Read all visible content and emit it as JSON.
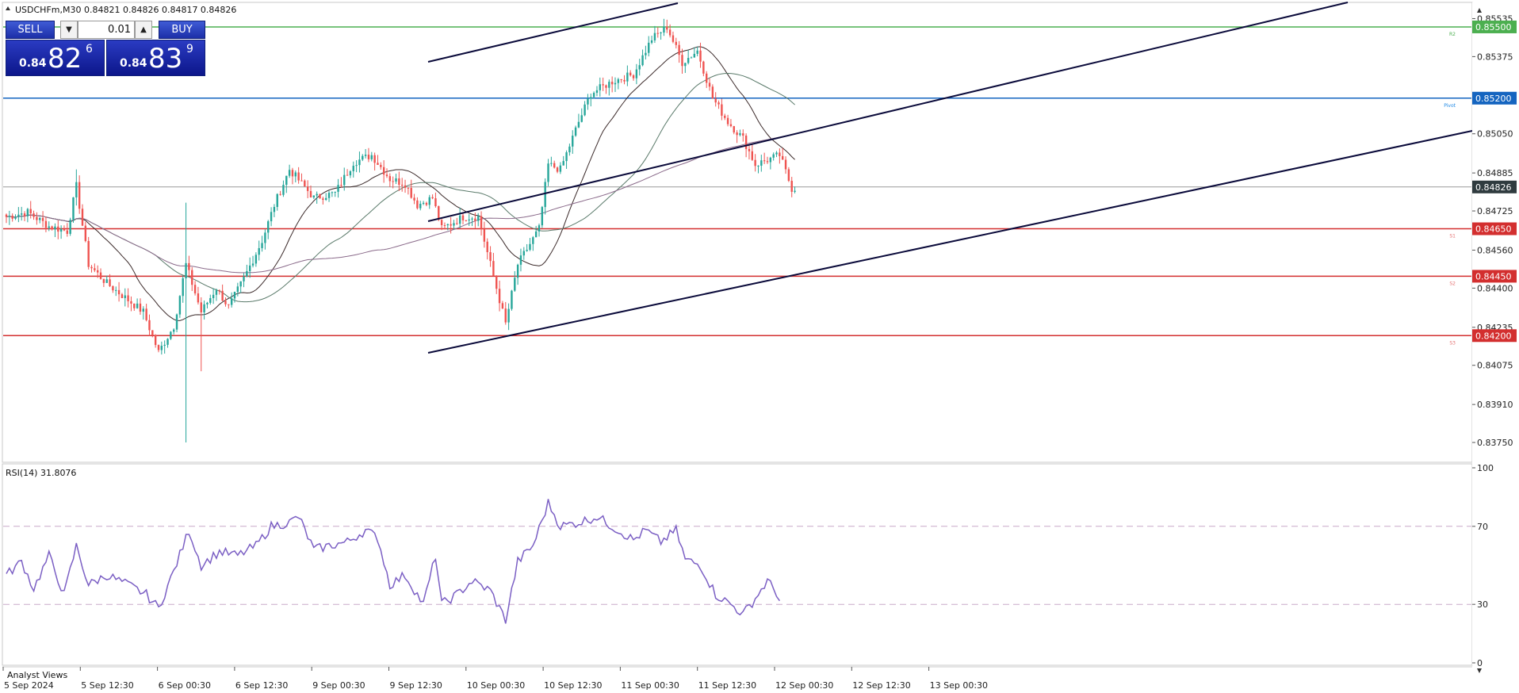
{
  "header": {
    "symbol_line": "USDCHFm,M30  0.84821 0.84826 0.84817 0.84826"
  },
  "trade_panel": {
    "sell_label": "SELL",
    "buy_label": "BUY",
    "lot": "0.01",
    "sell_price": {
      "prefix": "0.84",
      "big": "82",
      "sup": "6"
    },
    "buy_price": {
      "prefix": "0.84",
      "big": "83",
      "sup": "9"
    }
  },
  "rsi_label": "RSI(14) 31.8076",
  "analyst_views_label": "Analyst Views",
  "colors": {
    "bull": "#26a69a",
    "bear": "#ef5350",
    "support": "#d32f2f",
    "pivot": "#1565c0",
    "resistance": "#4caf50",
    "rsi": "#7b5fc4",
    "channel": "#0a0a3a"
  },
  "chart_data": [
    {
      "type": "candlestick",
      "symbol": "USDCHFm",
      "timeframe": "M30",
      "ylim": [
        0.8367,
        0.856
      ],
      "y_ticks": [
        "0.85535",
        "0.85375",
        "0.85050",
        "0.84885",
        "0.84725",
        "0.84560",
        "0.84400",
        "0.84235",
        "0.84075",
        "0.83910",
        "0.83750"
      ],
      "x_ticks": [
        "5 Sep 2024",
        "5 Sep 12:30",
        "6 Sep 00:30",
        "6 Sep 12:30",
        "9 Sep 00:30",
        "9 Sep 12:30",
        "10 Sep 00:30",
        "10 Sep 12:30",
        "11 Sep 00:30",
        "11 Sep 12:30",
        "12 Sep 00:30",
        "12 Sep 12:30",
        "13 Sep 00:30"
      ],
      "current_price": {
        "value": 0.84826,
        "label": "0.84826"
      },
      "levels": [
        {
          "name": "R2",
          "label": "0.85500",
          "value": 0.855,
          "kind": "resistance"
        },
        {
          "name": "Pivot",
          "label": "0.85200",
          "value": 0.852,
          "kind": "pivot"
        },
        {
          "name": "S1",
          "label": "0.84650",
          "value": 0.8465,
          "kind": "support"
        },
        {
          "name": "S2",
          "label": "0.84450",
          "value": 0.8445,
          "kind": "support"
        },
        {
          "name": "S3",
          "label": "0.84200",
          "value": 0.842,
          "kind": "support"
        }
      ],
      "keypoints": [
        [
          0,
          0.847
        ],
        [
          7,
          0.8472
        ],
        [
          14,
          0.8466
        ],
        [
          20,
          0.8464
        ],
        [
          23,
          0.8483
        ],
        [
          27,
          0.845
        ],
        [
          33,
          0.8442
        ],
        [
          45,
          0.843
        ],
        [
          50,
          0.8413
        ],
        [
          55,
          0.8424
        ],
        [
          59,
          0.845
        ],
        [
          64,
          0.843
        ],
        [
          69,
          0.844
        ],
        [
          73,
          0.8432
        ],
        [
          78,
          0.8444
        ],
        [
          84,
          0.846
        ],
        [
          88,
          0.8475
        ],
        [
          93,
          0.849
        ],
        [
          101,
          0.8478
        ],
        [
          108,
          0.848
        ],
        [
          114,
          0.8493
        ],
        [
          120,
          0.8496
        ],
        [
          126,
          0.8486
        ],
        [
          131,
          0.8484
        ],
        [
          135,
          0.8475
        ],
        [
          140,
          0.8478
        ],
        [
          143,
          0.8465
        ],
        [
          150,
          0.847
        ],
        [
          155,
          0.847
        ],
        [
          160,
          0.8445
        ],
        [
          164,
          0.8425
        ],
        [
          168,
          0.845
        ],
        [
          175,
          0.8465
        ],
        [
          178,
          0.8492
        ],
        [
          182,
          0.849
        ],
        [
          188,
          0.851
        ],
        [
          192,
          0.8522
        ],
        [
          199,
          0.8527
        ],
        [
          206,
          0.853
        ],
        [
          212,
          0.8545
        ],
        [
          217,
          0.855
        ],
        [
          222,
          0.8535
        ],
        [
          227,
          0.854
        ],
        [
          232,
          0.852
        ],
        [
          237,
          0.851
        ],
        [
          242,
          0.8503
        ],
        [
          246,
          0.8492
        ],
        [
          250,
          0.8494
        ],
        [
          254,
          0.8496
        ],
        [
          258,
          0.8482
        ]
      ]
    },
    {
      "type": "line",
      "title": "RSI(14) 31.8076",
      "ylim": [
        0,
        100
      ],
      "y_ticks": [
        "100",
        "70",
        "30",
        "0"
      ],
      "levels": [
        70,
        30
      ],
      "series": [
        {
          "name": "RSI(14)",
          "keypoints": [
            [
              0,
              45
            ],
            [
              5,
              52
            ],
            [
              9,
              38
            ],
            [
              14,
              55
            ],
            [
              19,
              35
            ],
            [
              23,
              60
            ],
            [
              27,
              40
            ],
            [
              33,
              45
            ],
            [
              40,
              40
            ],
            [
              46,
              35
            ],
            [
              50,
              28
            ],
            [
              55,
              47
            ],
            [
              60,
              68
            ],
            [
              64,
              50
            ],
            [
              70,
              57
            ],
            [
              76,
              55
            ],
            [
              82,
              60
            ],
            [
              87,
              70
            ],
            [
              93,
              72
            ],
            [
              96,
              75
            ],
            [
              101,
              58
            ],
            [
              106,
              60
            ],
            [
              112,
              62
            ],
            [
              118,
              68
            ],
            [
              122,
              64
            ],
            [
              126,
              40
            ],
            [
              131,
              45
            ],
            [
              137,
              30
            ],
            [
              141,
              55
            ],
            [
              143,
              30
            ],
            [
              148,
              35
            ],
            [
              153,
              42
            ],
            [
              159,
              37
            ],
            [
              164,
              22
            ],
            [
              168,
              52
            ],
            [
              173,
              60
            ],
            [
              178,
              82
            ],
            [
              182,
              70
            ],
            [
              188,
              72
            ],
            [
              194,
              75
            ],
            [
              199,
              70
            ],
            [
              206,
              63
            ],
            [
              210,
              68
            ],
            [
              215,
              62
            ],
            [
              220,
              68
            ],
            [
              223,
              53
            ],
            [
              228,
              50
            ],
            [
              233,
              35
            ],
            [
              238,
              30
            ],
            [
              242,
              25
            ],
            [
              246,
              33
            ],
            [
              250,
              42
            ],
            [
              253,
              36
            ],
            [
              254,
              32
            ]
          ]
        }
      ]
    }
  ]
}
